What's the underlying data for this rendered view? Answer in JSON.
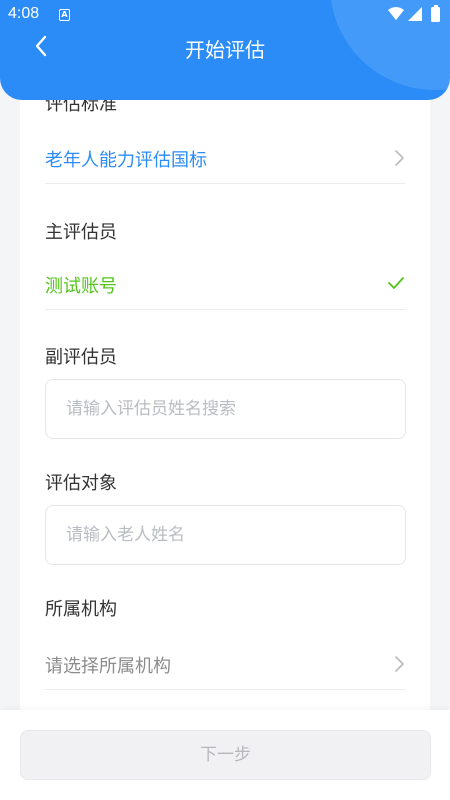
{
  "status_bar": {
    "time": "4:08",
    "notification_glyph": "A",
    "icons": [
      "wifi-icon",
      "signal-icon",
      "battery-icon"
    ]
  },
  "header": {
    "title": "开始评估",
    "back_icon": "chevron-left-icon",
    "color": "#2b8cf7"
  },
  "form": {
    "standard": {
      "label": "评估标准",
      "value": "老年人能力评估国标",
      "value_color": "#2b8cf7",
      "icon": "chevron-right-icon"
    },
    "main_assessor": {
      "label": "主评估员",
      "value": "测试账号",
      "value_color": "#52c41a",
      "icon": "check-icon"
    },
    "deputy_assessor": {
      "label": "副评估员",
      "placeholder": "请输入评估员姓名搜索",
      "value": ""
    },
    "subject": {
      "label": "评估对象",
      "placeholder": "请输入老人姓名",
      "value": ""
    },
    "institution": {
      "label": "所属机构",
      "value": "请选择所属机构",
      "icon": "chevron-right-icon"
    }
  },
  "footer": {
    "next_label": "下一步"
  }
}
